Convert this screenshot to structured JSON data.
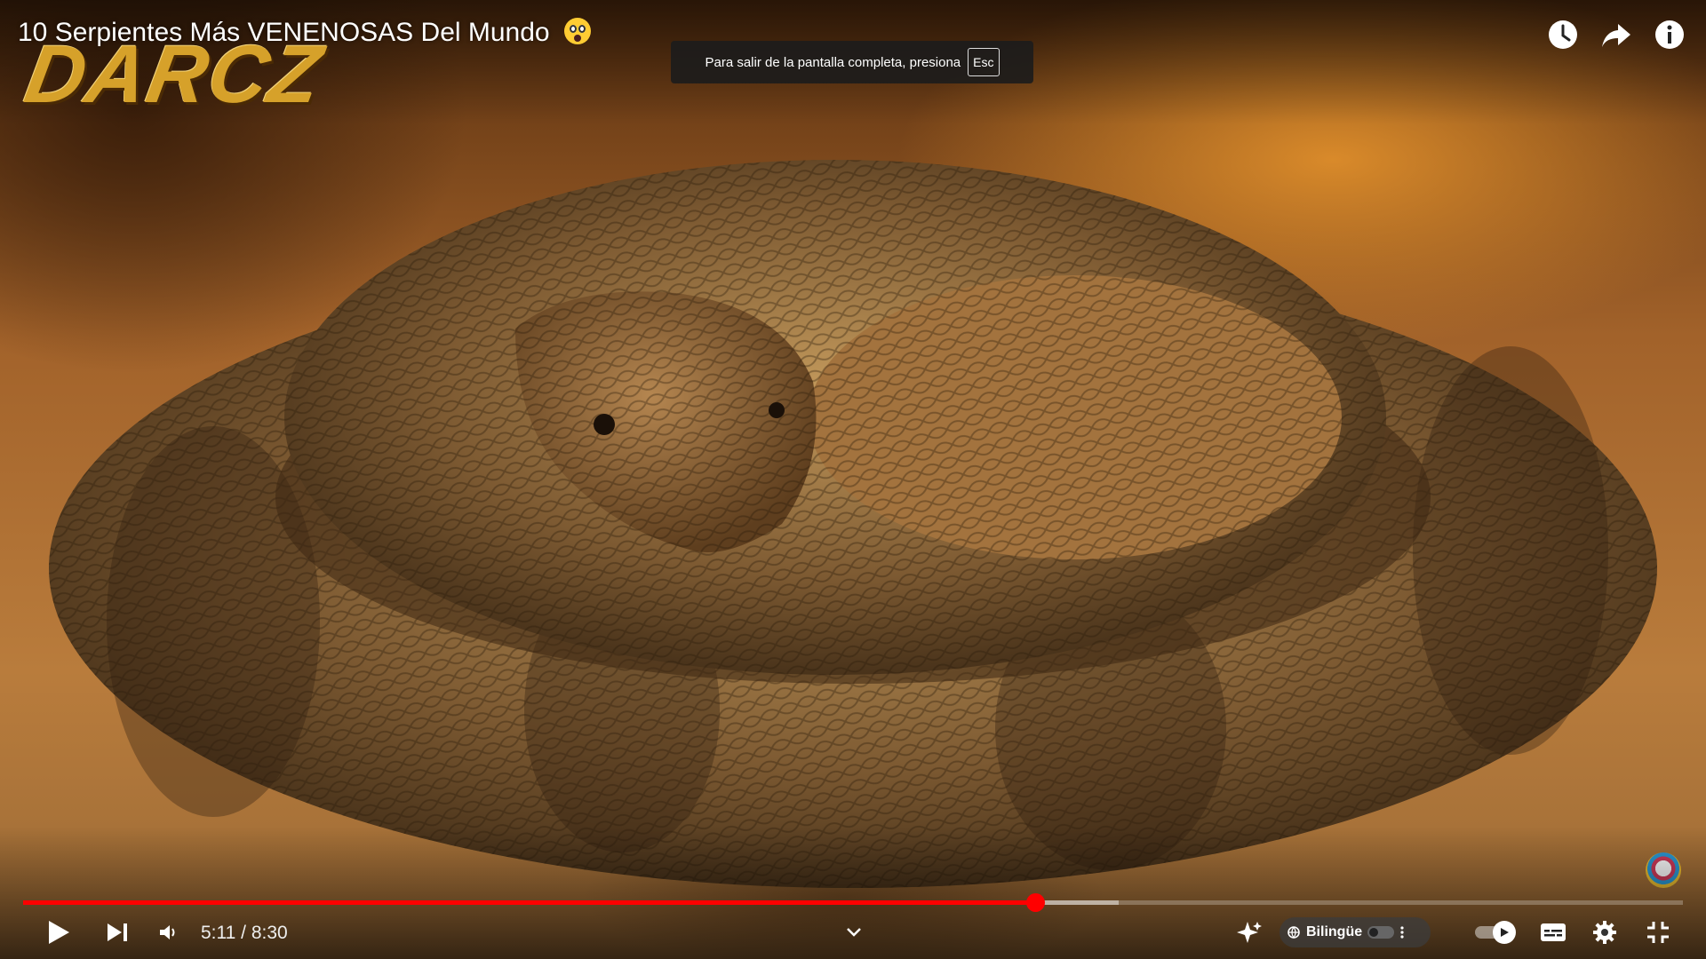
{
  "video": {
    "title": "10 Serpientes Más VENENOSAS Del Mundo",
    "title_emoji": "face-screaming-in-fear",
    "watermark": "DARCZ",
    "scene": "coiled-snake"
  },
  "toast": {
    "text": "Para salir de la pantalla completa, presiona",
    "key": "Esc"
  },
  "top_actions": [
    {
      "name": "watch-later",
      "icon": "clock-icon"
    },
    {
      "name": "share",
      "icon": "share-arrow-icon"
    },
    {
      "name": "info",
      "icon": "info-icon"
    }
  ],
  "player": {
    "current_time": "5:11",
    "separator": " / ",
    "duration": "8:30",
    "progress_fraction": 0.61,
    "buffered_fraction": 0.66,
    "time_text": "5:11 / 8:30"
  },
  "controls": {
    "play_icon": "play-icon",
    "next_icon": "skip-next-icon",
    "volume_icon": "volume-icon",
    "chapters_icon": "chevron-down-icon",
    "ai_icon": "sparkle-icon",
    "bilingual_label": "Bilingüe",
    "autoplay_on": true,
    "subtitles_icon": "subtitles-icon",
    "settings_icon": "gear-icon",
    "exit_fullscreen_icon": "exit-fullscreen-icon"
  },
  "colors": {
    "progress": "#ff0000",
    "text": "#ffffff"
  }
}
